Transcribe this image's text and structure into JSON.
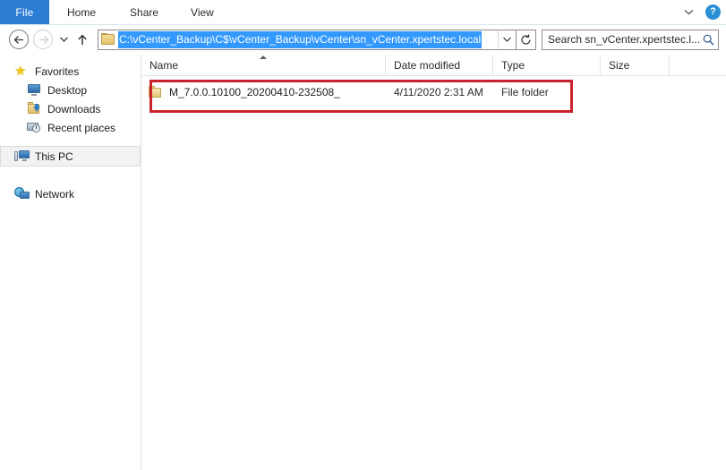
{
  "window": {
    "title": "sn_vCenter.xpertstec.local"
  },
  "ribbon": {
    "file_tab": "File",
    "tabs": [
      {
        "label": "Home"
      },
      {
        "label": "Share"
      },
      {
        "label": "View"
      }
    ],
    "expand_icon": "chevron-down-icon",
    "help_icon": "?"
  },
  "navbar": {
    "back_icon": "←",
    "forward_icon": "→",
    "recent_dropdown_icon": "▾",
    "up_icon": "↑",
    "address": {
      "value": "C:\\vCenter_Backup\\C$\\vCenter_Backup\\vCenter\\sn_vCenter.xpertstec.local",
      "selected": true,
      "dropdown_icon": "▾",
      "refresh_icon": "↻"
    },
    "search": {
      "placeholder": "Search sn_vCenter.xpertstec.l...",
      "value": "",
      "icon": "search-icon"
    }
  },
  "navpane": {
    "groups": [
      {
        "header": {
          "label": "Favorites",
          "icon": "star-icon"
        },
        "items": [
          {
            "label": "Desktop",
            "icon": "monitor-icon"
          },
          {
            "label": "Downloads",
            "icon": "downloads-folder-icon"
          },
          {
            "label": "Recent places",
            "icon": "recent-places-icon"
          }
        ]
      }
    ],
    "this_pc": {
      "label": "This PC",
      "icon": "computer-icon",
      "selected": true
    },
    "network": {
      "label": "Network",
      "icon": "network-icon"
    }
  },
  "file_list": {
    "columns": [
      {
        "key": "name",
        "label": "Name",
        "sorted": "asc"
      },
      {
        "key": "date",
        "label": "Date modified",
        "sorted": null
      },
      {
        "key": "type",
        "label": "Type",
        "sorted": null
      },
      {
        "key": "size",
        "label": "Size",
        "sorted": null
      }
    ],
    "rows": [
      {
        "name": "M_7.0.0.10100_20200410-232508_",
        "date": "4/11/2020 2:31 AM",
        "type": "File folder",
        "size": "",
        "icon": "folder-icon",
        "highlighted": true
      }
    ]
  },
  "annotation": {
    "color": "#c8232c",
    "target": "first-file-row"
  },
  "colors": {
    "file_tab_blue": "#2b7cd3",
    "selection_blue": "#3399ff",
    "help_blue": "#2b8fd6",
    "annotation_red": "#c8232c",
    "folder_yellow": "#e3c775"
  }
}
